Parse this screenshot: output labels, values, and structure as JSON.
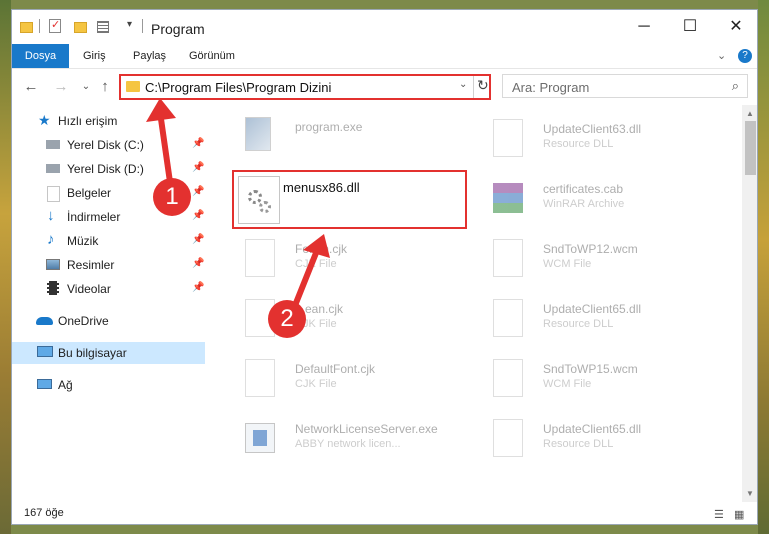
{
  "window": {
    "title": "Program",
    "controls": {
      "minimize": "─",
      "maximize": "☐",
      "close": "✕"
    }
  },
  "ribbon": {
    "tabs": [
      "Dosya",
      "Giriş",
      "Paylaş",
      "Görünüm"
    ],
    "collapse_icon": "⌄",
    "help_icon": "?"
  },
  "address": {
    "back": "←",
    "forward": "→",
    "recent": "⌄",
    "up": "↑",
    "path": "C:\\Program Files\\Program Dizini",
    "dropdown": "⌄",
    "refresh": "↻",
    "search_placeholder": "Ara: Program",
    "search_icon": "⌕"
  },
  "nav": {
    "items": [
      {
        "label": "Hızlı erişim",
        "icon": "star-icon",
        "pinned": false
      },
      {
        "label": "Yerel Disk (C:)",
        "icon": "drive-icon",
        "pinned": true
      },
      {
        "label": "Yerel Disk (D:)",
        "icon": "drive-icon",
        "pinned": true
      },
      {
        "label": "Belgeler",
        "icon": "documents-icon",
        "pinned": true
      },
      {
        "label": "İndirmeler",
        "icon": "downloads-icon",
        "pinned": true
      },
      {
        "label": "Müzik",
        "icon": "music-icon",
        "pinned": true
      },
      {
        "label": "Resimler",
        "icon": "pictures-icon",
        "pinned": true
      },
      {
        "label": "Videolar",
        "icon": "videos-icon",
        "pinned": true
      },
      {
        "label": "OneDrive",
        "icon": "onedrive-icon",
        "pinned": false
      },
      {
        "label": "Bu bilgisayar",
        "icon": "computer-icon",
        "pinned": false
      },
      {
        "label": "Ağ",
        "icon": "network-icon",
        "pinned": false
      }
    ],
    "pin_glyph": "📌"
  },
  "files": {
    "program_exe": {
      "name": "program.exe",
      "type": ""
    },
    "menusx86": {
      "name": "menusx86.dll"
    },
    "f_cjk1": {
      "name": "Fo...m.cjk",
      "type": "CJK File"
    },
    "f_cjk2": {
      "name": "...ean.cjk",
      "type": "CJK File"
    },
    "defaultfont": {
      "name": "DefaultFont.cjk",
      "type": "CJK File"
    },
    "netlicense": {
      "name": "NetworkLicenseServer.exe",
      "type": "ABBY network licen..."
    },
    "update63": {
      "name": "UpdateClient63.dll",
      "type": "Resource DLL"
    },
    "certificates": {
      "name": "certificates.cab",
      "type": "WinRAR Archive"
    },
    "sndwp12": {
      "name": "SndToWP12.wcm",
      "type": "WCM File"
    },
    "update65a": {
      "name": "UpdateClient65.dll",
      "type": "Resource DLL"
    },
    "sndwp15": {
      "name": "SndToWP15.wcm",
      "type": "WCM File"
    },
    "update65b": {
      "name": "UpdateClient65.dll",
      "type": "Resource DLL"
    }
  },
  "status": {
    "count": "167 öğe"
  },
  "callouts": [
    "1",
    "2"
  ],
  "colors": {
    "accent": "#1979ca",
    "highlight": "#e3312f",
    "selected": "#cce8ff"
  }
}
